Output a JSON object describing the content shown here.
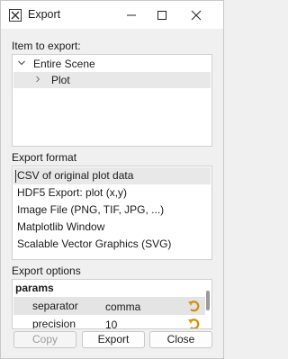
{
  "window": {
    "title": "Export"
  },
  "item_section": {
    "label": "Item to export:",
    "items": [
      {
        "label": "Entire Scene",
        "expanded": true
      },
      {
        "label": "Plot",
        "expanded": false,
        "selected": true
      }
    ]
  },
  "format_section": {
    "label": "Export format",
    "formats": [
      "CSV of original plot data",
      "HDF5 Export: plot (x,y)",
      "Image File (PNG, TIF, JPG, ...)",
      "Matplotlib Window",
      "Scalable Vector Graphics (SVG)"
    ],
    "selected": "CSV of original plot data"
  },
  "options_section": {
    "label": "Export options",
    "group": "params",
    "params": [
      {
        "name": "separator",
        "value": "comma"
      },
      {
        "name": "precision",
        "value": "10"
      }
    ]
  },
  "buttons": {
    "copy": "Copy",
    "export": "Export",
    "close": "Close"
  },
  "colors": {
    "selection": "#e8e8e8",
    "reset_icon": "#e0a020"
  }
}
